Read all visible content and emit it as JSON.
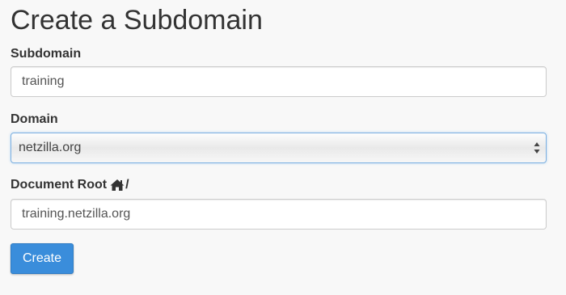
{
  "page": {
    "title": "Create a Subdomain"
  },
  "form": {
    "subdomain": {
      "label": "Subdomain",
      "value": "training"
    },
    "domain": {
      "label": "Domain",
      "selected": "netzilla.org"
    },
    "document_root": {
      "label": "Document Root",
      "label_suffix": "/",
      "icon": "home-icon",
      "value": "training.netzilla.org"
    },
    "create_button": {
      "label": "Create"
    }
  },
  "colors": {
    "button_bg": "#3a8ddb",
    "focus_border": "#7aaee0",
    "page_bg": "#f8f8f8"
  }
}
